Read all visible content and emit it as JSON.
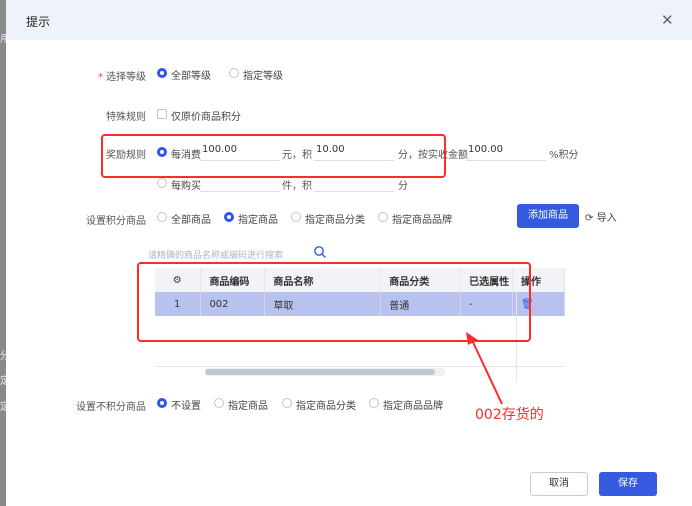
{
  "dialog": {
    "title": "提示",
    "close_icon": "close-icon"
  },
  "backdrop_fragments": [
    "用",
    "分",
    "定",
    "定",
    "设"
  ],
  "level": {
    "label": "选择等级",
    "options": [
      "全部等级",
      "指定等级"
    ],
    "selected": 0
  },
  "special_rule": {
    "label": "特殊规则",
    "checkbox_label": "仅原价商品积分",
    "checked": false
  },
  "reward_rule": {
    "label": "奖励规则",
    "row1": {
      "prefix": "每消费",
      "amount": "100.00",
      "unit1": "元，积",
      "points": "10.00",
      "unit2": "分，按实收金额",
      "percent": "100.00",
      "unit3": "%积分"
    },
    "row2": {
      "prefix": "每购买",
      "unit1": "件，积",
      "unit2": "分"
    }
  },
  "points_goods": {
    "label": "设置积分商品",
    "options": [
      "全部商品",
      "指定商品",
      "指定商品分类",
      "指定商品品牌"
    ],
    "selected": 1,
    "add_button": "添加商品",
    "import_label": "导入",
    "search_placeholder": "请精确的商品名称或编码进行搜索"
  },
  "table": {
    "columns": [
      "商品编码",
      "商品名称",
      "商品分类",
      "已选属性",
      "操作"
    ],
    "rows": [
      {
        "index": "1",
        "code": "002",
        "name": "草取",
        "category": "普通",
        "attr": "-"
      }
    ]
  },
  "non_points_goods": {
    "label": "设置不积分商品",
    "options": [
      "不设置",
      "指定商品",
      "指定商品分类",
      "指定商品品牌"
    ],
    "selected": 0
  },
  "annotation": {
    "text": "002存货的",
    "color": "#ff2b2b"
  },
  "footer": {
    "cancel": "取消",
    "save": "保存"
  },
  "colors": {
    "primary": "#3559e0",
    "selected_row": "#b9c2ee",
    "annotation": "#ff2b2b",
    "header_bg": "#eef2fb"
  }
}
